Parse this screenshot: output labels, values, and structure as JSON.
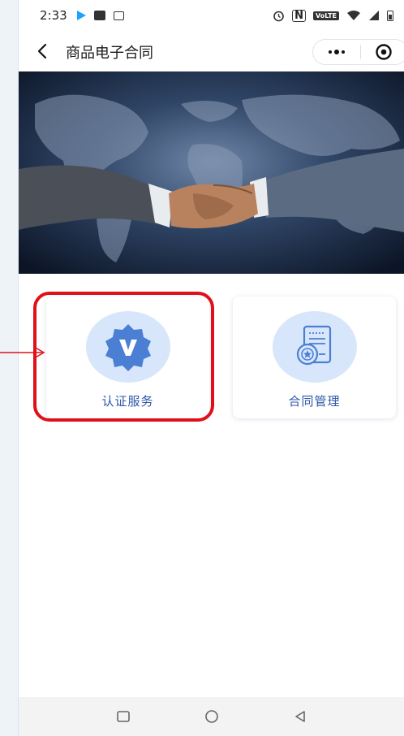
{
  "status_bar": {
    "time": "2:33",
    "network": "VoLTE"
  },
  "nav": {
    "title": "商品电子合同"
  },
  "cards": [
    {
      "label": "认证服务",
      "icon": "verified-badge-icon",
      "highlighted": true
    },
    {
      "label": "合同管理",
      "icon": "contract-document-icon",
      "highlighted": false
    }
  ],
  "colors": {
    "accent": "#4a7fd4",
    "icon_bg": "#d8e6fb",
    "label": "#2d57a8",
    "highlight": "#e0101a"
  }
}
